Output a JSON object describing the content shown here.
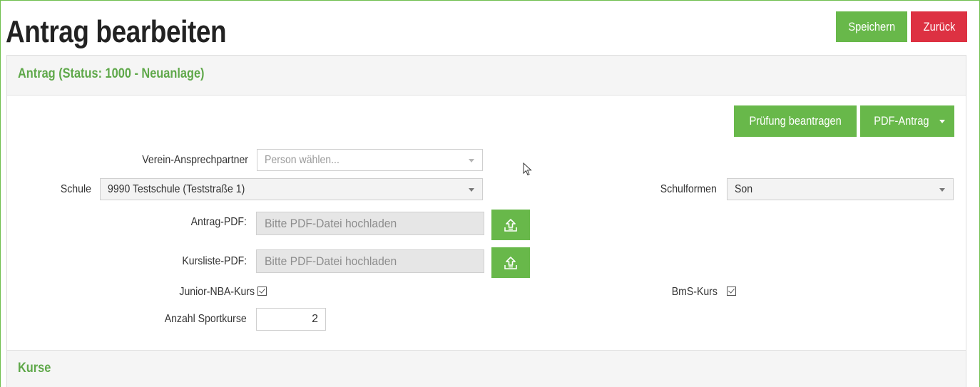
{
  "page": {
    "title": "Antrag bearbeiten"
  },
  "toolbar": {
    "save_label": "Speichern",
    "back_label": "Zurück"
  },
  "panel": {
    "title": "Antrag (Status: 1000 - Neuanlage)",
    "actions": {
      "pruefung_label": "Prüfung beantragen",
      "pdf_antrag_label": "PDF-Antrag"
    }
  },
  "form": {
    "verein_ansprechpartner": {
      "label": "Verein-Ansprechpartner",
      "placeholder": "Person wählen..."
    },
    "schule": {
      "label": "Schule",
      "value": "9990 Testschule (Teststraße 1)"
    },
    "schulformen": {
      "label": "Schulformen",
      "value": "Son"
    },
    "antrag_pdf": {
      "label": "Antrag-PDF:",
      "placeholder": "Bitte PDF-Datei hochladen"
    },
    "kursliste_pdf": {
      "label": "Kursliste-PDF:",
      "placeholder": "Bitte PDF-Datei hochladen"
    },
    "junior_nba_kurs": {
      "label": "Junior-NBA-Kurs",
      "checked": true
    },
    "bms_kurs": {
      "label": "BmS-Kurs",
      "checked": true
    },
    "anzahl_sportkurse": {
      "label": "Anzahl Sportkurse",
      "value": "2"
    }
  },
  "sections": {
    "kurse_title": "Kurse"
  },
  "icons": {
    "upload": "upload-icon",
    "caret": "caret-down-icon",
    "cursor": "mouse-pointer-icon"
  },
  "colors": {
    "accent": "#68b84a",
    "danger": "#dd3142",
    "heading_text": "#5fa84a"
  }
}
